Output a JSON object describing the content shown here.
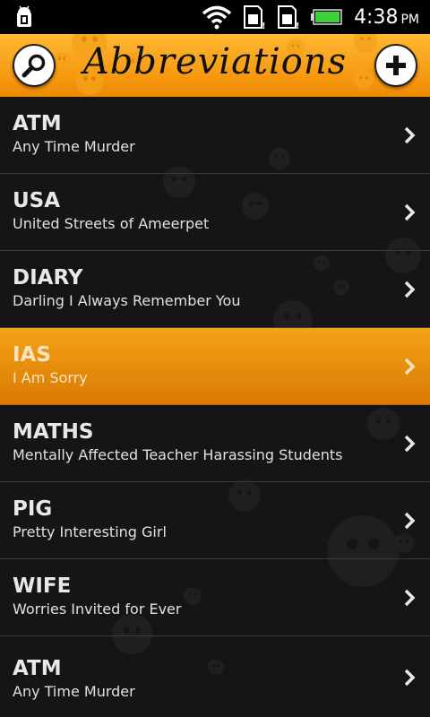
{
  "status_bar": {
    "time": "4:38",
    "ampm": "PM",
    "icons": [
      "android-debug-icon",
      "wifi-icon",
      "sd-card-icon",
      "sd-card-icon",
      "battery-icon"
    ]
  },
  "header": {
    "title": "Abbreviations",
    "left_button_icon": "search-icon",
    "right_button_icon": "plus-icon"
  },
  "list": {
    "items": [
      {
        "abbr": "ATM",
        "meaning": "Any Time Murder"
      },
      {
        "abbr": "USA",
        "meaning": "United Streets of Ameerpet"
      },
      {
        "abbr": "DIARY",
        "meaning": "Darling I Always Remember You"
      },
      {
        "abbr": "IAS",
        "meaning": "I Am Sorry",
        "selected": true
      },
      {
        "abbr": "MATHS",
        "meaning": "Mentally Affected Teacher Harassing Students"
      },
      {
        "abbr": "PIG",
        "meaning": "Pretty Interesting Girl"
      },
      {
        "abbr": "WIFE",
        "meaning": "Worries Invited for Ever"
      },
      {
        "abbr": "ATM",
        "meaning": "Any Time Murder"
      }
    ]
  },
  "colors": {
    "header_orange": "#f5a316",
    "selected_row": "#e58c0b",
    "background": "#151515"
  }
}
